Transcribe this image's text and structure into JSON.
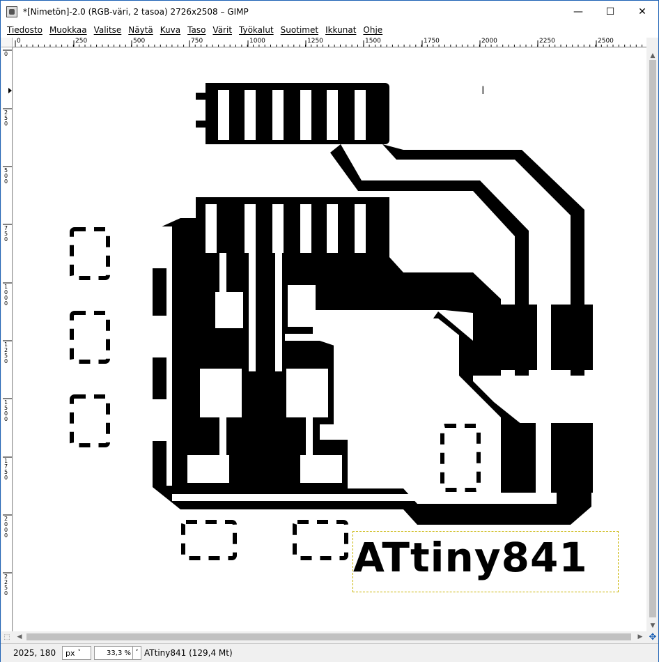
{
  "window": {
    "title": "*[Nimetön]-2.0 (RGB-väri, 2 tasoa) 2726x2508 – GIMP",
    "minimize_icon": "—",
    "maximize_icon": "☐",
    "close_icon": "✕"
  },
  "menu": [
    "Tiedosto",
    "Muokkaa",
    "Valitse",
    "Näytä",
    "Kuva",
    "Taso",
    "Värit",
    "Työkalut",
    "Suotimet",
    "Ikkunat",
    "Ohje"
  ],
  "rulers": {
    "horizontal": [
      "0",
      "250",
      "500",
      "750",
      "1000",
      "1250",
      "1500",
      "1750",
      "2000",
      "2250",
      "2500"
    ],
    "vertical": [
      "0",
      "250",
      "500",
      "750",
      "1000",
      "1250",
      "1500",
      "1750",
      "2000",
      "2250"
    ]
  },
  "canvas": {
    "text_layer": "ATtiny841"
  },
  "status": {
    "coordinates": "2025, 180",
    "unit": "px",
    "zoom": "33,3 %",
    "layer_info": "ATtiny841 (129,4 Mt)"
  }
}
